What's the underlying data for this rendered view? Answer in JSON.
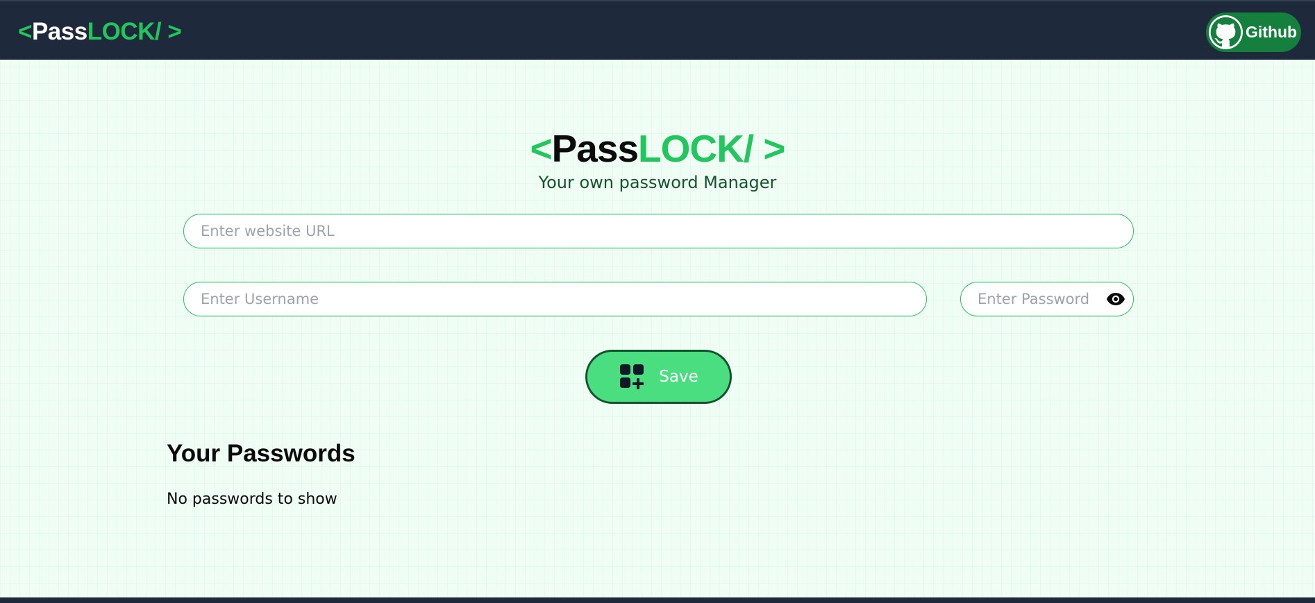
{
  "navbar": {
    "logo": {
      "open": "<",
      "pass": "Pass",
      "lock": "LOCK/",
      "close": " >"
    },
    "github": {
      "label": "Github",
      "icon": "github-icon"
    }
  },
  "hero": {
    "logo": {
      "open": "<",
      "pass": "Pass",
      "lock": "LOCK/",
      "close": " >"
    },
    "tagline": "Your own password Manager"
  },
  "form": {
    "url": {
      "placeholder": "Enter website URL",
      "value": ""
    },
    "username": {
      "placeholder": "Enter Username",
      "value": ""
    },
    "password": {
      "placeholder": "Enter Password",
      "value": "",
      "toggle_icon": "eye-icon"
    },
    "save": {
      "label": "Save",
      "icon": "add-grid-icon"
    }
  },
  "passwords": {
    "title": "Your Passwords",
    "empty_message": "No passwords to show"
  },
  "colors": {
    "accent": "#22c55e",
    "navbar": "#1e293b",
    "save_button": "#4ade80",
    "github_button": "#15803d",
    "background": "#effdf4"
  }
}
